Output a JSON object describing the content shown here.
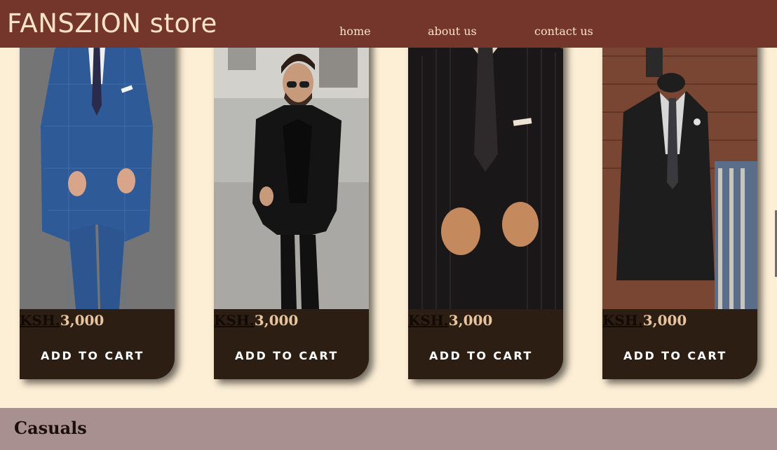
{
  "nav": {
    "brand": "FANSZION store",
    "links": [
      {
        "label": "home"
      },
      {
        "label": "about us"
      },
      {
        "label": "contact us"
      }
    ]
  },
  "products": [
    {
      "currency": "KSH.",
      "price": "3,000",
      "cta": "ADD TO CART",
      "image": "blue-plaid-three-piece-suit"
    },
    {
      "currency": "KSH.",
      "price": "3,000",
      "cta": "ADD TO CART",
      "image": "black-suit-sunglasses-street"
    },
    {
      "currency": "KSH.",
      "price": "3,000",
      "cta": "ADD TO CART",
      "image": "pinstripe-suit-buttoning-jacket"
    },
    {
      "currency": "KSH.",
      "price": "3,000",
      "cta": "ADD TO CART",
      "image": "suit-on-mannequin-shop"
    }
  ],
  "section": {
    "title": "Casuals"
  },
  "colors": {
    "navbar": "#74362b",
    "page_bg": "#fdefd6",
    "card_bg": "#2c1e12",
    "price_text": "#e9c59f",
    "band": "#a99090"
  }
}
